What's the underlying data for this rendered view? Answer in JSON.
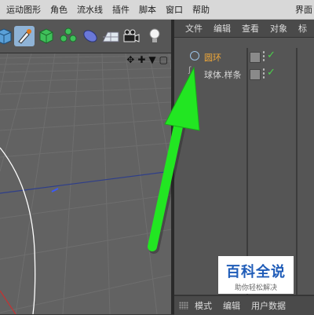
{
  "menu": [
    "运动图形",
    "角色",
    "流水线",
    "插件",
    "脚本",
    "窗口",
    "帮助"
  ],
  "menu_right": "界面",
  "toolbar_icons": [
    "cube-icon",
    "brush-icon",
    "green-cube-icon",
    "cloner-icon",
    "deformer-icon",
    "floor-icon",
    "camera-icon",
    "light-icon"
  ],
  "viewport_icons": [
    "✥",
    "✚",
    "▼",
    "▢"
  ],
  "panel": {
    "tabs": [
      "文件",
      "编辑",
      "查看",
      "对象",
      "标"
    ],
    "objects": [
      {
        "name": "圆环",
        "icon": "circle-icon",
        "active": true
      },
      {
        "name": "球体.样条",
        "icon": "spline-icon",
        "active": false
      }
    ],
    "footer_tabs": [
      "模式",
      "编辑",
      "用户数据"
    ]
  },
  "watermark": {
    "title": "百科全说",
    "subtitle": "助你轻松解决"
  },
  "colors": {
    "active_label": "#f0a838",
    "arrow": "#22e622",
    "check": "#4cd24c",
    "watermark_blue": "#1f5cb8"
  }
}
